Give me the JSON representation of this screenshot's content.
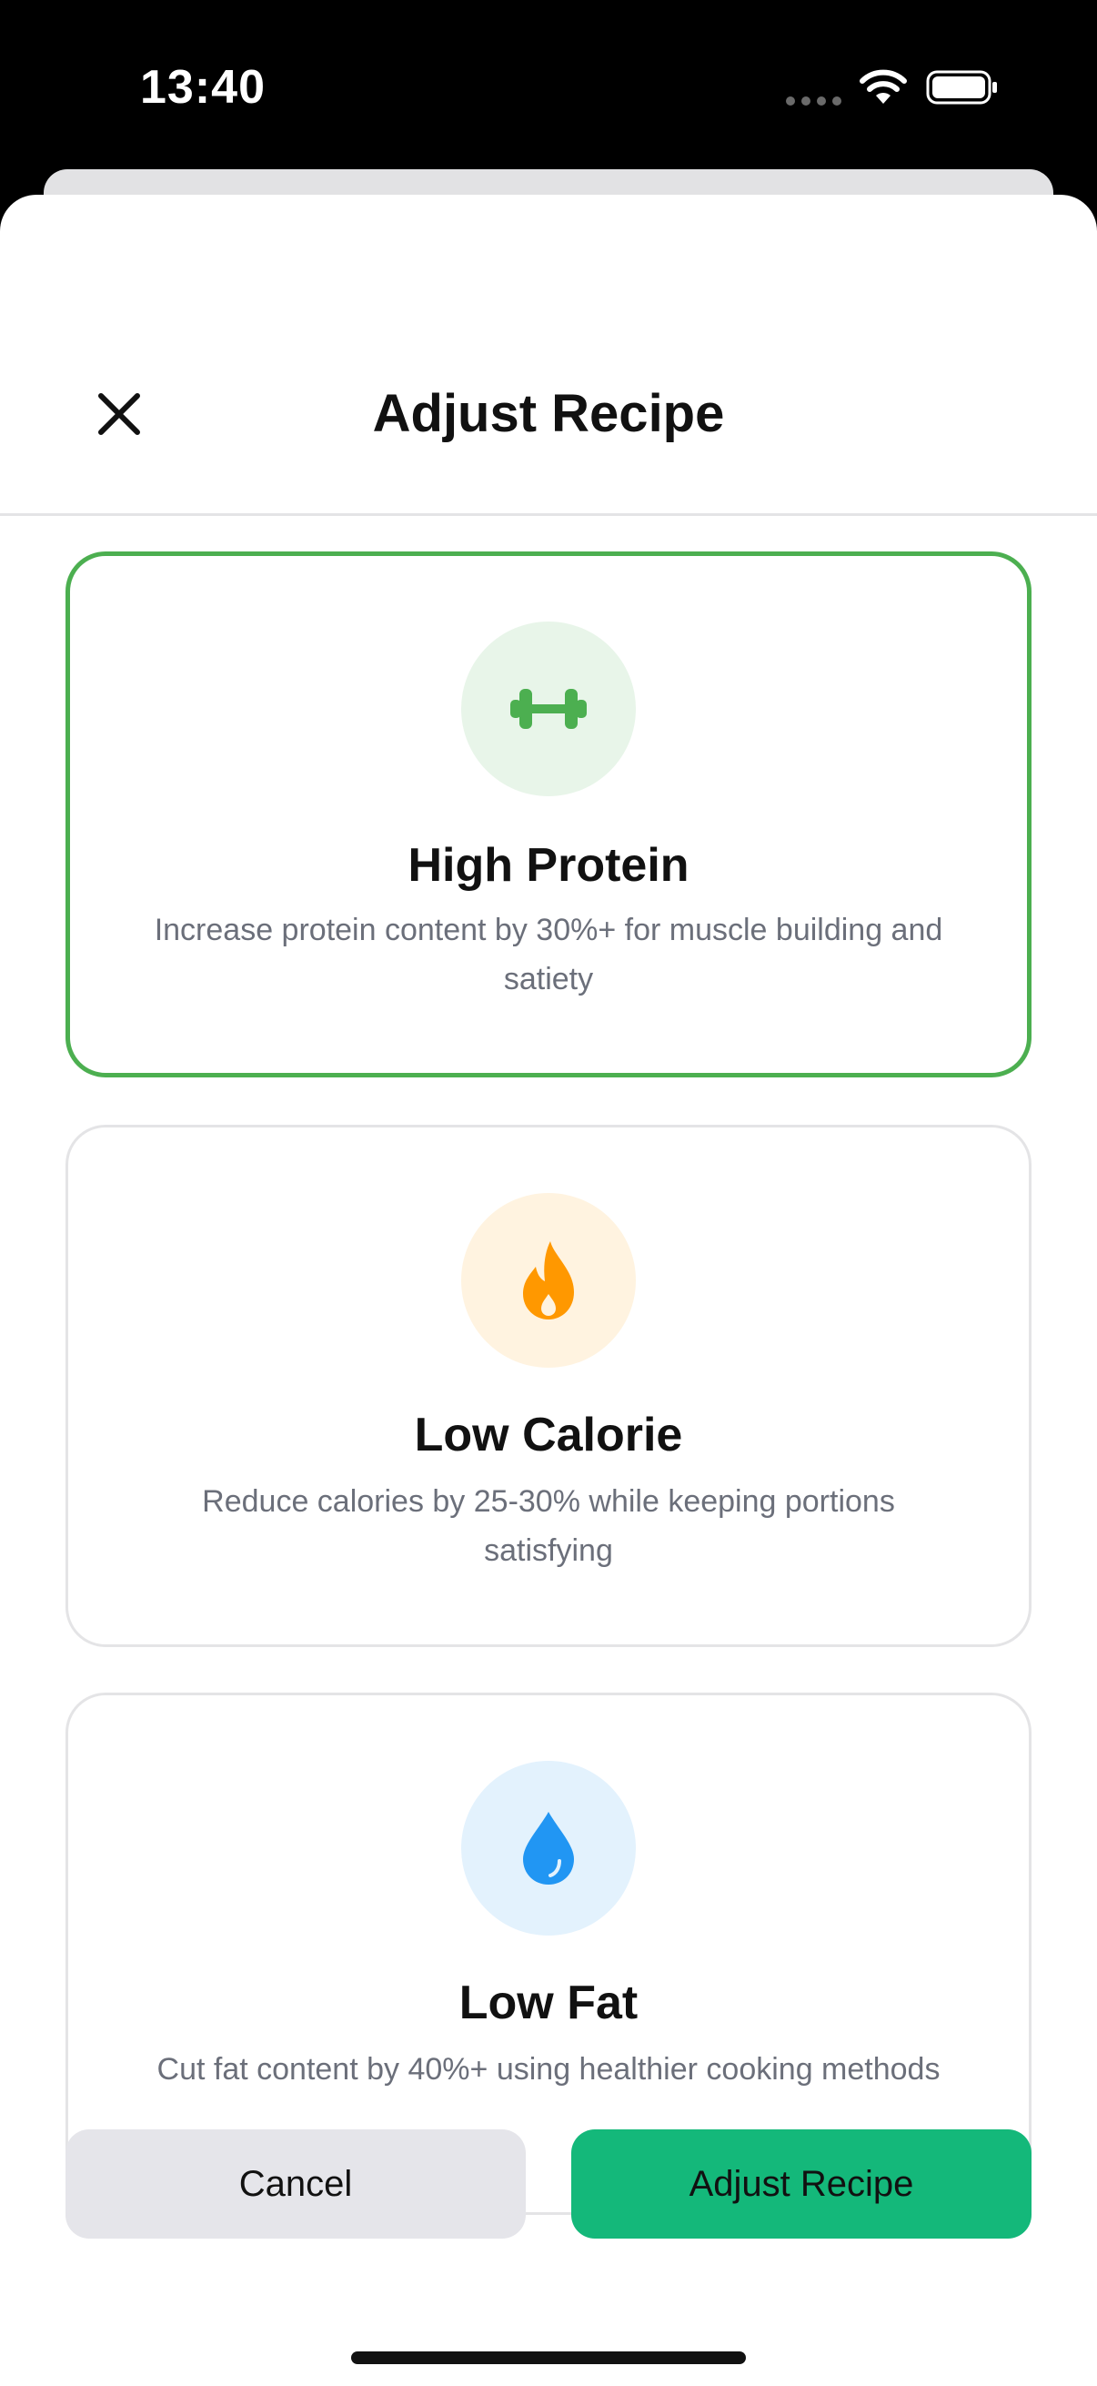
{
  "status_bar": {
    "time": "13:40"
  },
  "header": {
    "title": "Adjust Recipe",
    "close_icon": "close-icon"
  },
  "options": [
    {
      "title": "High Protein",
      "description": "Increase protein content by 30%+ for muscle building and satiety",
      "icon": "dumbbell-icon",
      "icon_color": "#4caf50",
      "icon_bg": "#e8f5e9",
      "selected": true
    },
    {
      "title": "Low Calorie",
      "description": "Reduce calories by 25-30% while keeping portions satisfying",
      "icon": "flame-icon",
      "icon_color": "#ff9800",
      "icon_bg": "#fff3e0",
      "selected": false
    },
    {
      "title": "Low Fat",
      "description": "Cut fat content by 40%+ using healthier cooking methods",
      "icon": "water-drop-icon",
      "icon_color": "#2196f3",
      "icon_bg": "#e3f2fd",
      "selected": false
    }
  ],
  "footer": {
    "cancel_label": "Cancel",
    "adjust_label": "Adjust Recipe"
  },
  "colors": {
    "accent_selected": "#4caf50",
    "primary_button": "#14b87a"
  }
}
